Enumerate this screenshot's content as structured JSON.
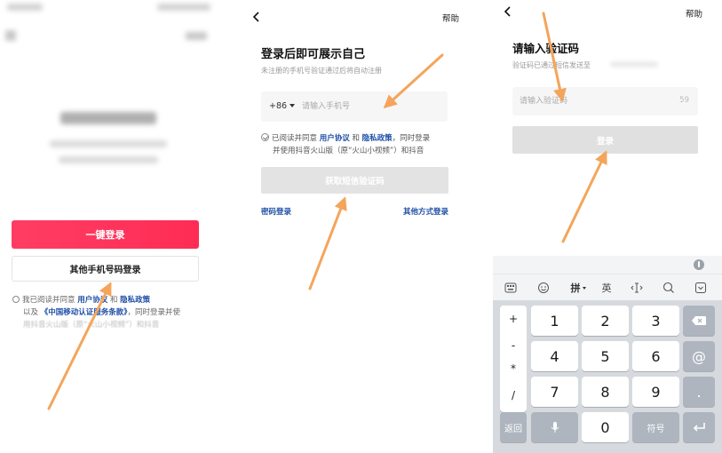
{
  "panel1": {
    "one_key_login": "一键登录",
    "other_phone_login": "其他手机号码登录",
    "agreement": {
      "prefix": "我已阅读并同意",
      "user_agreement": "用户协议",
      "and": "和",
      "privacy_policy": "隐私政策",
      "line2_prefix": "以及",
      "cmcc_terms": "《中国移动认证服务条款》",
      "line2_suffix": "，同时登录并使",
      "line3": "用抖音火山版（原“火山小视频”）和抖音"
    }
  },
  "panel2": {
    "help": "帮助",
    "title": "登录后即可展示自己",
    "subtitle": "未注册的手机号验证通过后将自动注册",
    "country_code": "+86",
    "phone_placeholder": "请输入手机号",
    "agreement": {
      "prefix": "已阅读并同意",
      "user_agreement": "用户协议",
      "and": "和",
      "privacy_policy": "隐私政策",
      "suffix": "，同时登录",
      "line2": "并使用抖音火山版（原“火山小视频”）和抖音"
    },
    "get_code_button": "获取短信验证码",
    "password_login": "密码登录",
    "other_login": "其他方式登录"
  },
  "panel3": {
    "help": "帮助",
    "title": "请输入验证码",
    "subtitle": "验证码已通过短信发送至",
    "code_placeholder": "请输入验证码",
    "countdown": "59",
    "login_button": "登录",
    "keyboard": {
      "tools": {
        "pinyin": "拼",
        "english": "英"
      },
      "symbols": [
        "+",
        "-",
        "*",
        "/"
      ],
      "keys": [
        "1",
        "2",
        "3",
        "4",
        "5",
        "6",
        "7",
        "8",
        "9",
        "0"
      ],
      "at": "@",
      "dot": ".",
      "back": "返回",
      "symbol_key": "符号"
    }
  },
  "colors": {
    "primary_red": "#fe2c55",
    "link_blue": "#1f4fa6",
    "disabled_gray": "#e0e0e0",
    "arrow_orange": "#f4a55b"
  }
}
